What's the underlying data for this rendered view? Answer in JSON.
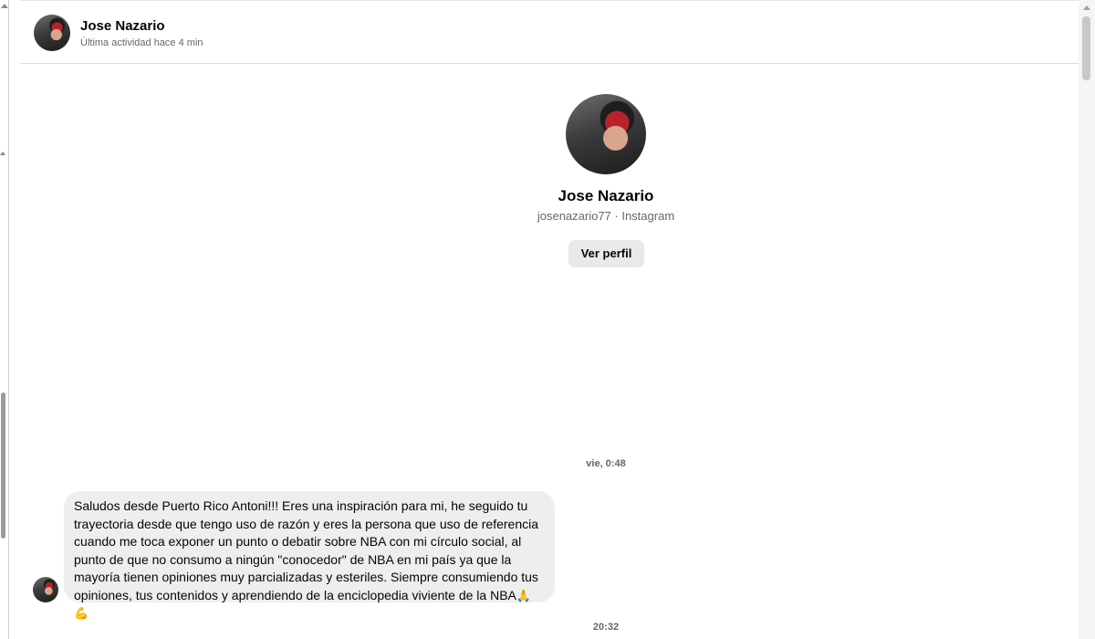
{
  "header": {
    "name": "Jose Nazario",
    "status": "Última actividad hace 4 min"
  },
  "profile": {
    "name": "Jose Nazario",
    "subtitle": "josenazario77 · Instagram",
    "button_label": "Ver perfil"
  },
  "messages": [
    {
      "timestamp": "vie, 0:48",
      "text": "Saludos desde Puerto Rico Antoni!!! Eres una inspiración para mi, he seguido tu trayectoria desde que tengo uso de razón y eres la persona que uso de referencia cuando me toca exponer un punto o debatir sobre NBA con mi círculo social, al punto de que no consumo a ningún \"conocedor\" de NBA en mi país ya que la mayoría tienen opiniones muy parcializadas y esteriles. Siempre consumiendo tus opiniones, tus contenidos y aprendiendo de la enciclopedia viviente de la NBA",
      "emojis": "🙏💪"
    }
  ],
  "next_timestamp": "20:32",
  "icons": {
    "avatar": "profile-photo",
    "scroll_up": "scroll-up-arrow-icon"
  }
}
